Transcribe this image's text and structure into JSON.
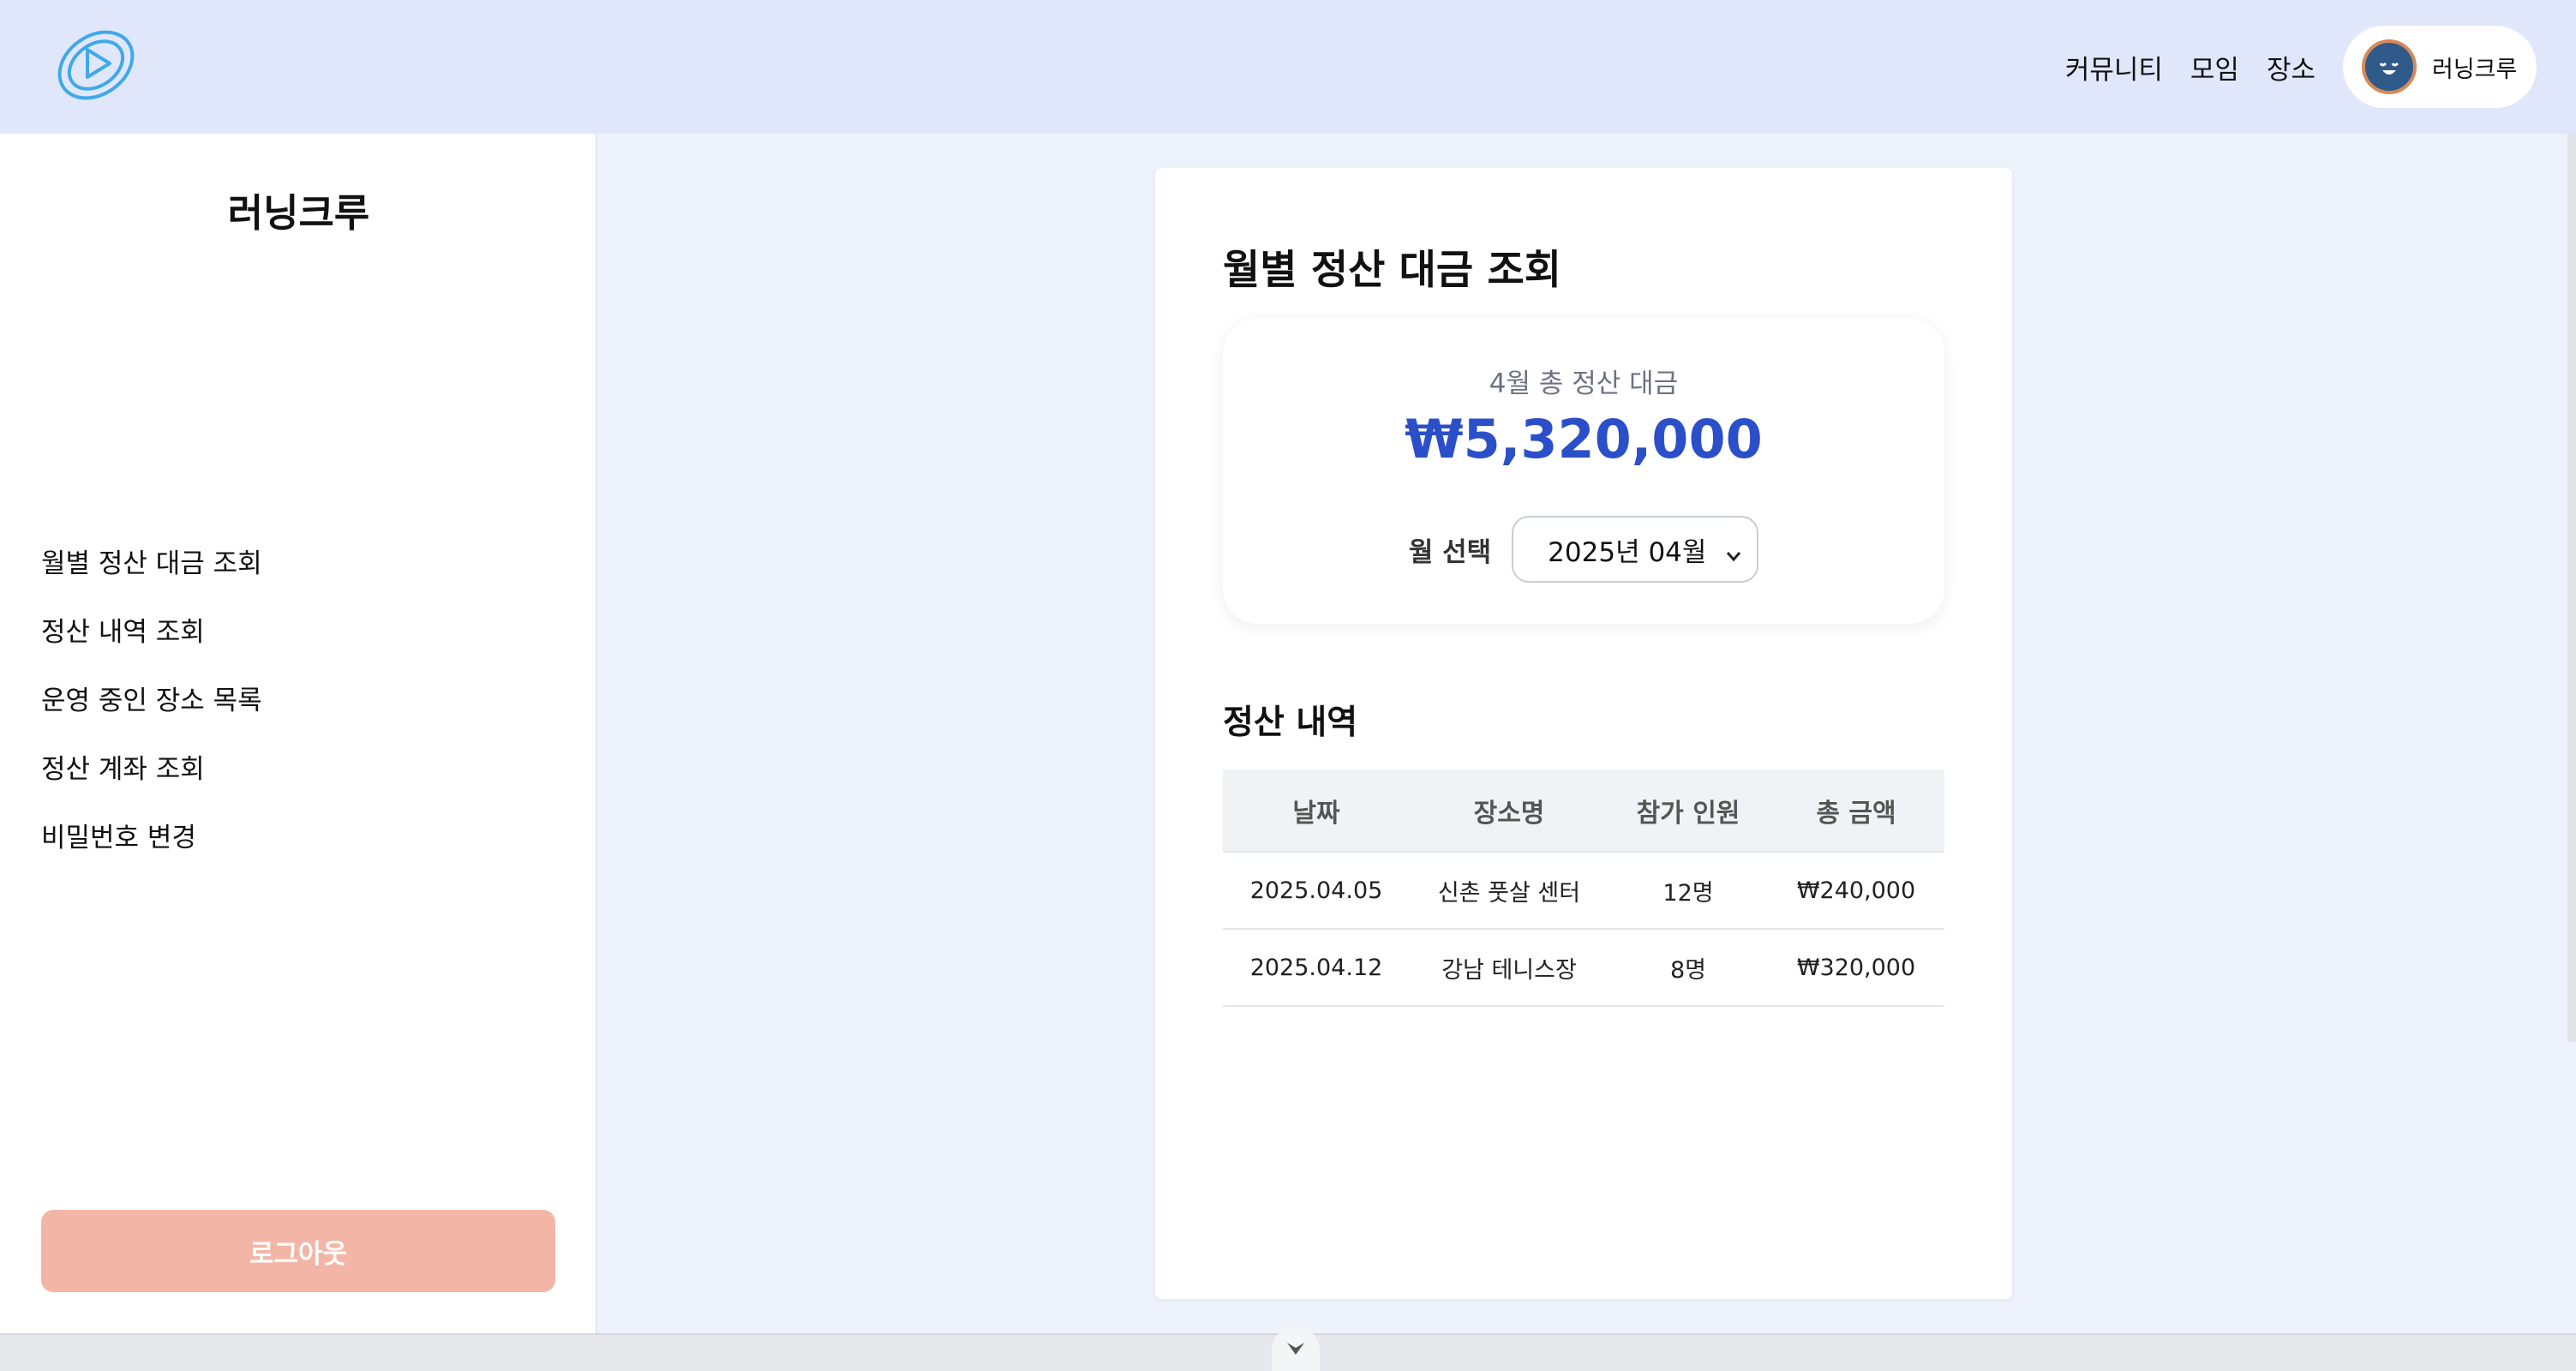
{
  "header": {
    "nav": [
      "커뮤니티",
      "모임",
      "장소"
    ],
    "profile_name": "러닝크루"
  },
  "sidebar": {
    "title": "러닝크루",
    "items": [
      {
        "label": "월별 정산 대금 조회"
      },
      {
        "label": "정산 내역 조회"
      },
      {
        "label": "운영 중인 장소 목록"
      },
      {
        "label": "정산 계좌 조회"
      },
      {
        "label": "비밀번호 변경"
      }
    ],
    "logout_label": "로그아웃"
  },
  "main": {
    "title": "월별 정산 대금 조회",
    "summary": {
      "label": "4월 총 정산 대금",
      "amount": "₩5,320,000",
      "month_label": "월 선택",
      "month_value": "2025년 04월"
    },
    "history": {
      "title": "정산 내역",
      "columns": [
        "날짜",
        "장소명",
        "참가 인원",
        "총 금액"
      ],
      "rows": [
        [
          "2025.04.05",
          "신촌 풋살 센터",
          "12명",
          "₩240,000"
        ],
        [
          "2025.04.12",
          "강남 테니스장",
          "8명",
          "₩320,000"
        ]
      ]
    }
  },
  "colors": {
    "header_bg": "#e1e7fb",
    "accent_amount": "#2b4fc9",
    "logout_bg": "#f3b6a6",
    "logo": "#3fa9e8"
  },
  "icons": {
    "logo": "play-logo-icon",
    "avatar": "avatar-icon",
    "select_arrow": "chevron-down-icon",
    "scroll": "scroll-down-icon"
  }
}
